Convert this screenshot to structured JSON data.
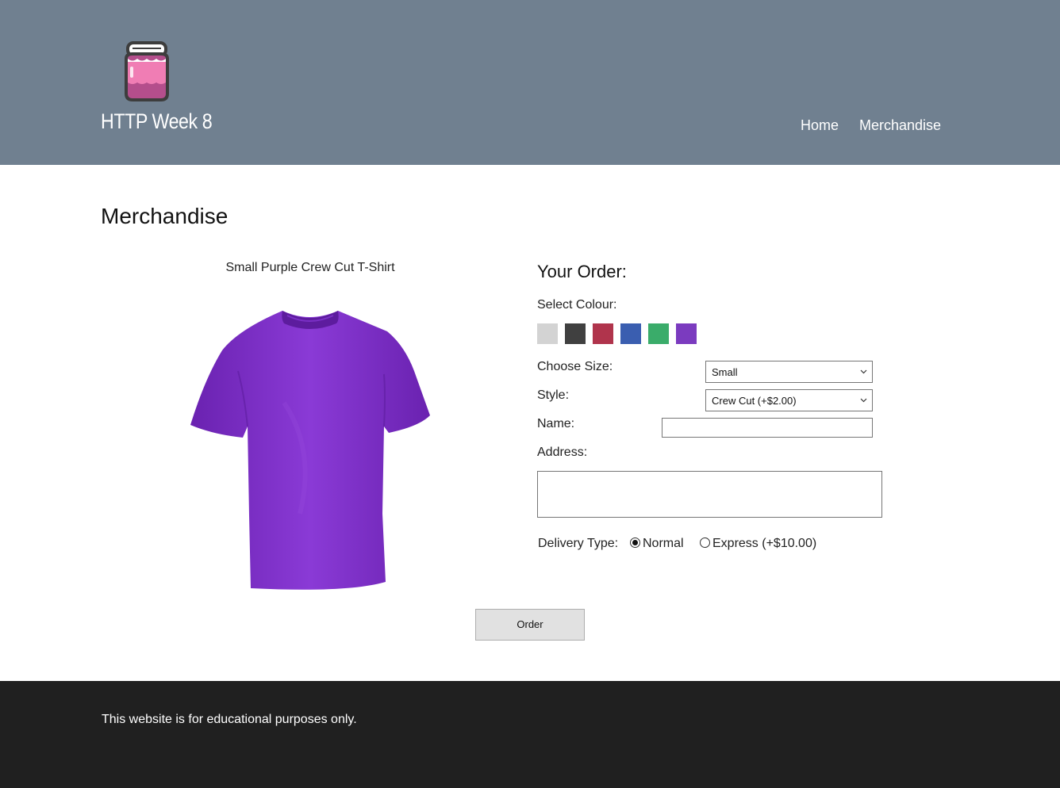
{
  "site": {
    "title": "HTTP Week 8",
    "logo": "jam-jar-logo"
  },
  "nav": {
    "home": "Home",
    "merchandise": "Merchandise"
  },
  "page": {
    "title": "Merchandise"
  },
  "product": {
    "caption": "Small Purple Crew Cut T-Shirt",
    "image": "purple-tshirt",
    "color": "#7b2fc0"
  },
  "order": {
    "title": "Your Order:",
    "colour_label": "Select Colour:",
    "swatches": [
      {
        "name": "light-grey",
        "color": "#d3d3d3"
      },
      {
        "name": "dark-grey",
        "color": "#404040"
      },
      {
        "name": "red",
        "color": "#b0344c"
      },
      {
        "name": "blue",
        "color": "#3a5eb0"
      },
      {
        "name": "green",
        "color": "#3aac6a"
      },
      {
        "name": "purple",
        "color": "#7b3bbf"
      }
    ],
    "size_label": "Choose Size:",
    "size_value": "Small",
    "style_label": "Style:",
    "style_value": "Crew Cut (+$2.00)",
    "name_label": "Name:",
    "name_value": "",
    "address_label": "Address:",
    "address_value": "",
    "delivery_label": "Delivery Type:",
    "delivery_options": [
      {
        "label": "Normal",
        "checked": true
      },
      {
        "label": "Express (+$10.00)",
        "checked": false
      }
    ],
    "button_label": "Order"
  },
  "footer": {
    "text": "This website is for educational purposes only."
  },
  "colors": {
    "header_bg": "#708090",
    "footer_bg": "#202020"
  }
}
